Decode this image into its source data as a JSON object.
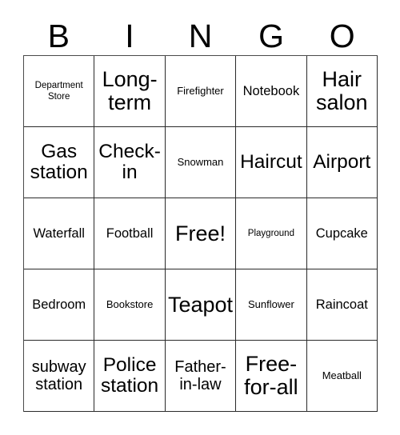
{
  "card": {
    "header_letters": [
      "B",
      "I",
      "N",
      "G",
      "O"
    ],
    "rows": [
      [
        {
          "label": "Department\nStore",
          "size": "xs"
        },
        {
          "label": "Long-\nterm",
          "size": "xxl"
        },
        {
          "label": "Firefighter",
          "size": "s"
        },
        {
          "label": "Notebook",
          "size": "m"
        },
        {
          "label": "Hair\nsalon",
          "size": "xxl"
        }
      ],
      [
        {
          "label": "Gas\nstation",
          "size": "xl"
        },
        {
          "label": "Check-\nin",
          "size": "xl"
        },
        {
          "label": "Snowman",
          "size": "s"
        },
        {
          "label": "Haircut",
          "size": "xl"
        },
        {
          "label": "Airport",
          "size": "xl"
        }
      ],
      [
        {
          "label": "Waterfall",
          "size": "m"
        },
        {
          "label": "Football",
          "size": "m"
        },
        {
          "label": "Free!",
          "size": "xxl"
        },
        {
          "label": "Playground",
          "size": "xs"
        },
        {
          "label": "Cupcake",
          "size": "m"
        }
      ],
      [
        {
          "label": "Bedroom",
          "size": "m"
        },
        {
          "label": "Bookstore",
          "size": "s"
        },
        {
          "label": "Teapot",
          "size": "xxl"
        },
        {
          "label": "Sunflower",
          "size": "s"
        },
        {
          "label": "Raincoat",
          "size": "m"
        }
      ],
      [
        {
          "label": "subway\nstation",
          "size": "l"
        },
        {
          "label": "Police\nstation",
          "size": "xl"
        },
        {
          "label": "Father-\nin-law",
          "size": "l"
        },
        {
          "label": "Free-\nfor-all",
          "size": "xxl"
        },
        {
          "label": "Meatball",
          "size": "s"
        }
      ]
    ]
  },
  "colors": {
    "background": "#ffffff",
    "text": "#000000",
    "grid_line": "#2a2a2a"
  }
}
